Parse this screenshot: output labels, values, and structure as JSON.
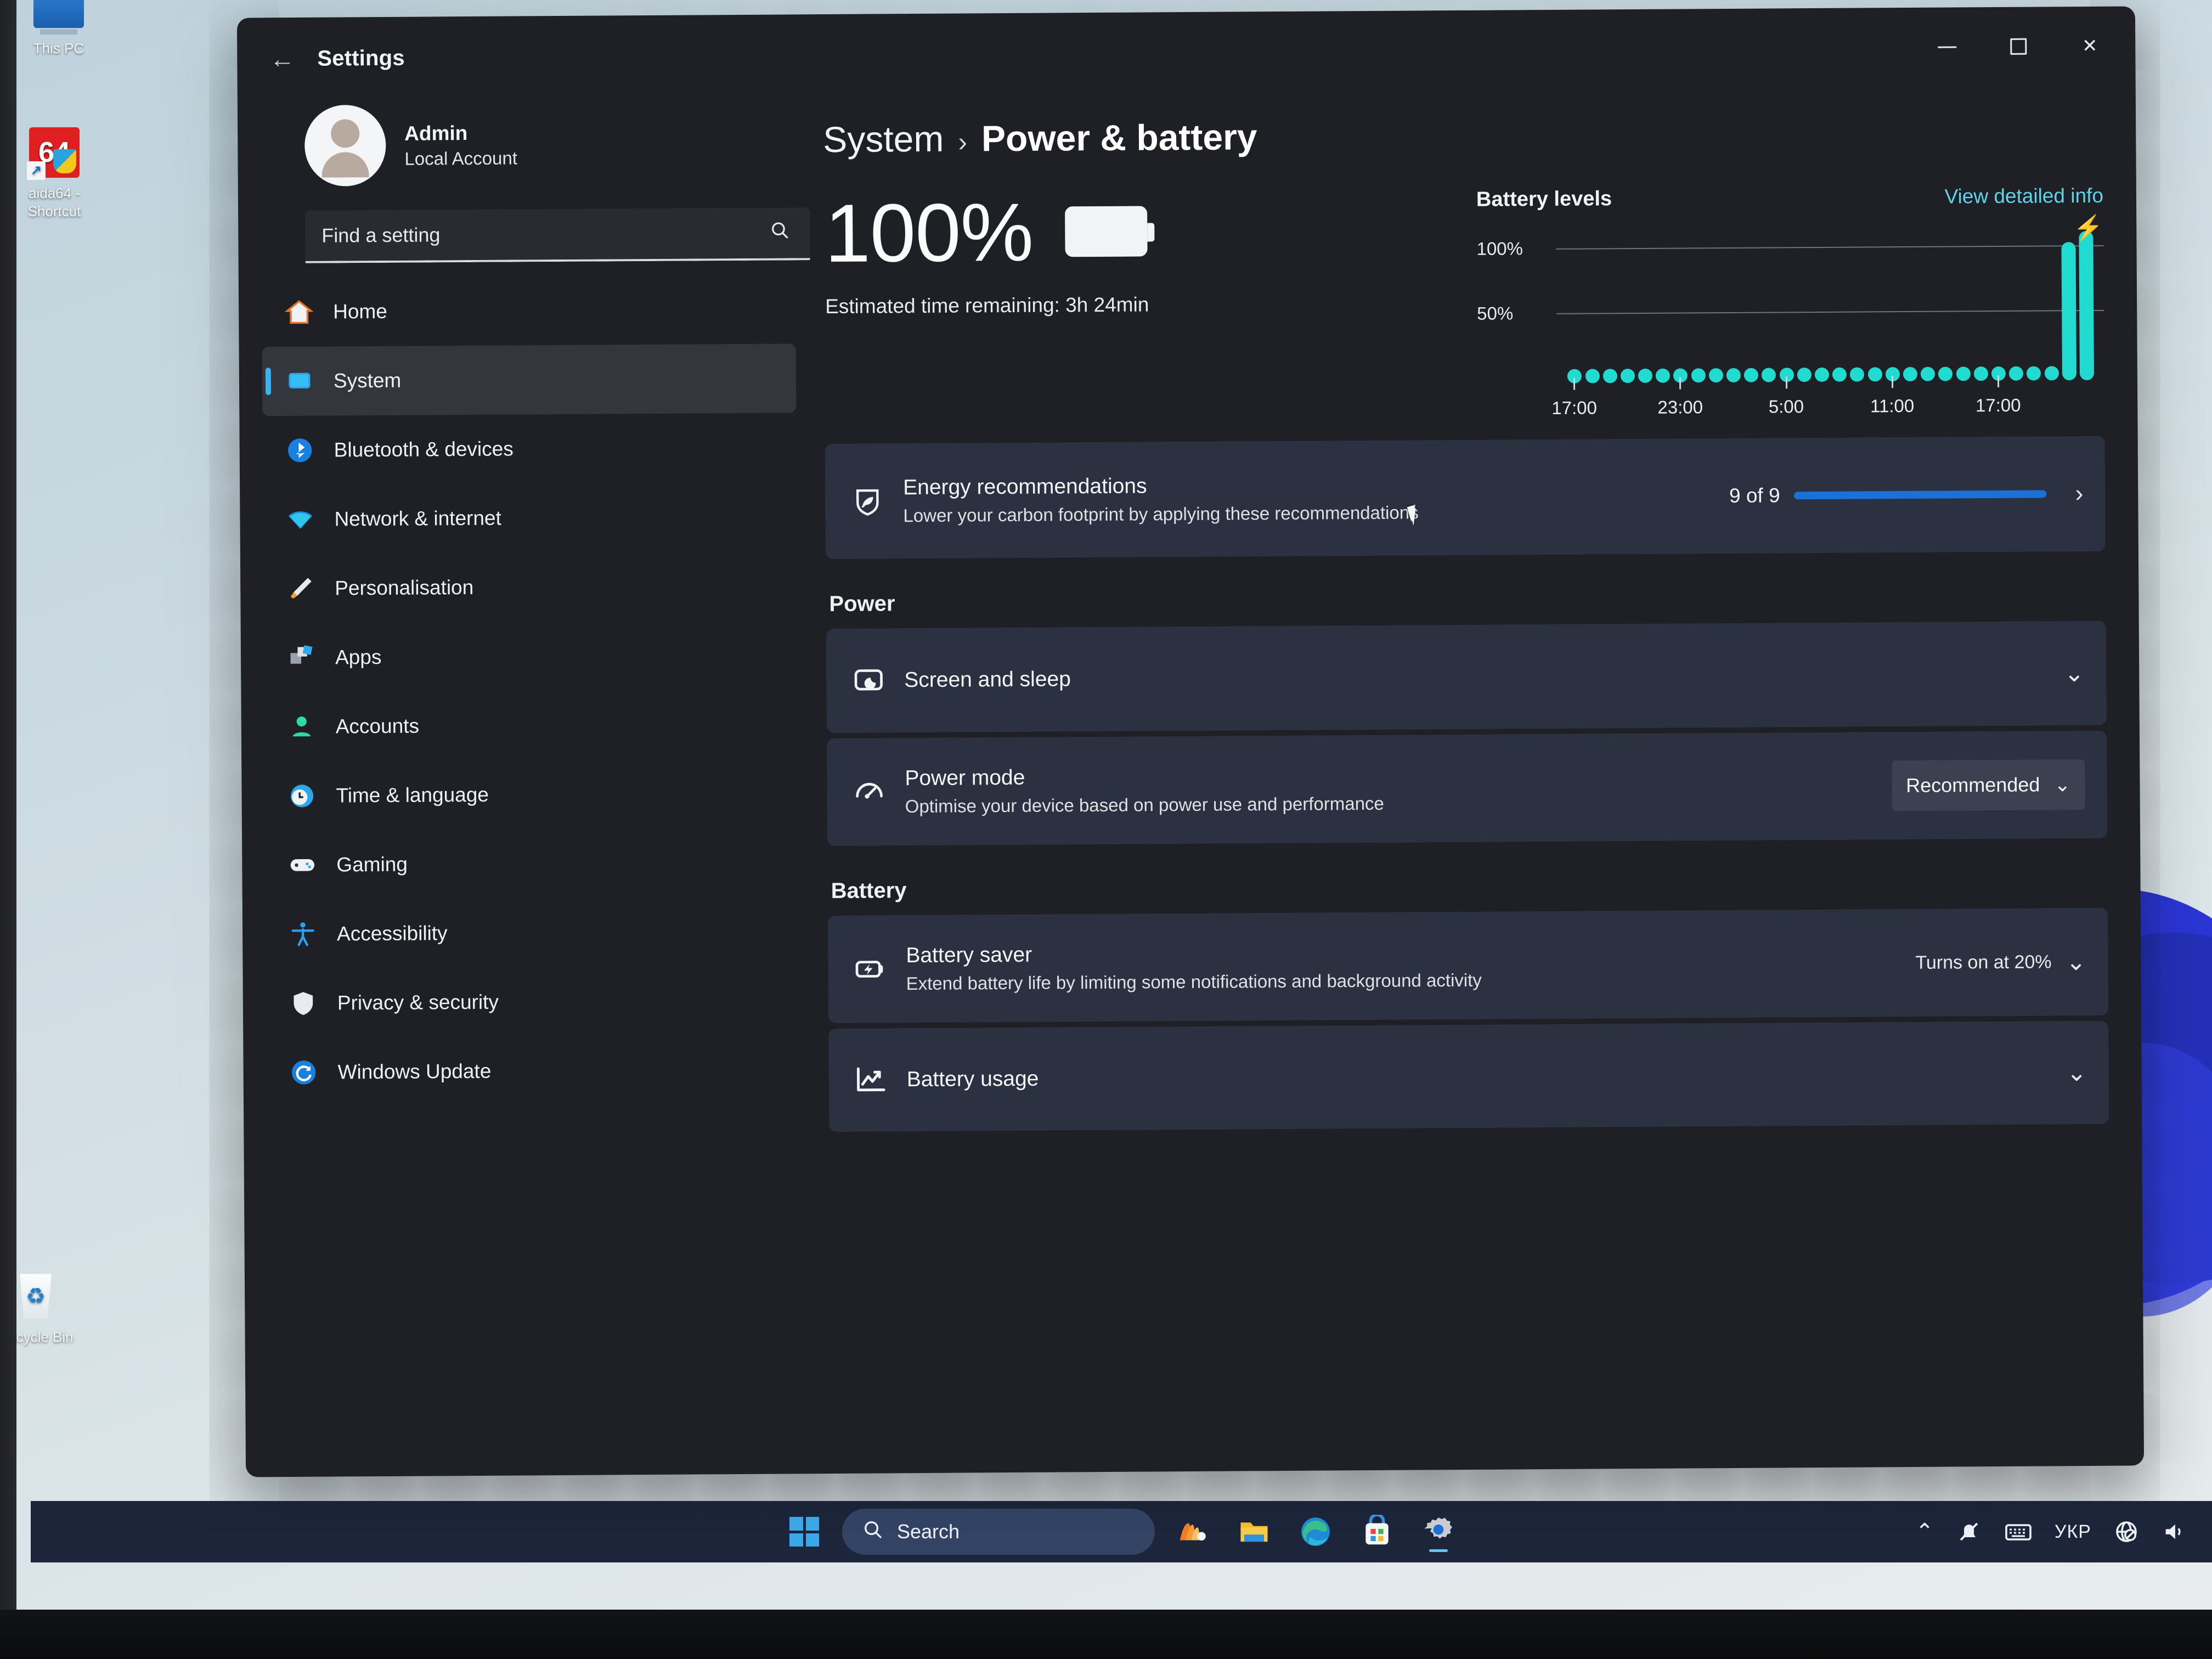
{
  "desktop": {
    "icons": [
      {
        "label": "This PC",
        "icon": "this-pc-icon"
      },
      {
        "label": "aida64 - Shortcut",
        "icon": "aida64-icon",
        "badge": "64"
      },
      {
        "label": "Recycle Bin",
        "icon": "recycle-bin-icon"
      }
    ]
  },
  "window": {
    "title": "Settings",
    "back_glyph": "←",
    "controls": {
      "minimize": "−",
      "maximize": "□",
      "close": "✕"
    }
  },
  "sidebar": {
    "account": {
      "name": "Admin",
      "subtitle": "Local Account"
    },
    "search": {
      "placeholder": "Find a setting",
      "icon": "search-icon"
    },
    "items": [
      {
        "label": "Home",
        "icon": "home-icon",
        "active": false
      },
      {
        "label": "System",
        "icon": "system-icon",
        "active": true
      },
      {
        "label": "Bluetooth & devices",
        "icon": "bluetooth-icon",
        "active": false
      },
      {
        "label": "Network & internet",
        "icon": "wifi-icon",
        "active": false
      },
      {
        "label": "Personalisation",
        "icon": "brush-icon",
        "active": false
      },
      {
        "label": "Apps",
        "icon": "apps-icon",
        "active": false
      },
      {
        "label": "Accounts",
        "icon": "account-icon",
        "active": false
      },
      {
        "label": "Time & language",
        "icon": "clock-icon",
        "active": false
      },
      {
        "label": "Gaming",
        "icon": "gamepad-icon",
        "active": false
      },
      {
        "label": "Accessibility",
        "icon": "accessibility-icon",
        "active": false
      },
      {
        "label": "Privacy & security",
        "icon": "shield-icon",
        "active": false
      },
      {
        "label": "Windows Update",
        "icon": "update-icon",
        "active": false
      }
    ]
  },
  "breadcrumb": {
    "parent": "System",
    "separator": "›",
    "current": "Power & battery"
  },
  "hero": {
    "percent": "100%",
    "battery_icon": "battery-full-icon",
    "estimated_time": "Estimated time remaining: 3h 24min"
  },
  "chart_data": {
    "type": "bar",
    "title": "Battery levels",
    "link_label": "View detailed info",
    "xlabel": "",
    "ylabel": "",
    "ylim": [
      0,
      100
    ],
    "ytick_labels": [
      "100%",
      "50%"
    ],
    "ytick_values": [
      100,
      50
    ],
    "xtick_labels": [
      "17:00",
      "23:00",
      "5:00",
      "11:00",
      "17:00"
    ],
    "xtick_positions": [
      0,
      6,
      12,
      18,
      24
    ],
    "grid": true,
    "legend": null,
    "bar_color": "#22dbd0",
    "annotation": {
      "symbol": "⚡",
      "meaning": "charging",
      "at_index": 29
    },
    "x": [
      "17:00",
      "18:00",
      "19:00",
      "20:00",
      "21:00",
      "22:00",
      "23:00",
      "00:00",
      "01:00",
      "02:00",
      "03:00",
      "04:00",
      "05:00",
      "06:00",
      "07:00",
      "08:00",
      "09:00",
      "10:00",
      "11:00",
      "12:00",
      "13:00",
      "14:00",
      "15:00",
      "16:00",
      "16:30",
      "17:00",
      "17:10",
      "17:20",
      "17:30",
      "17:40"
    ],
    "values": [
      0,
      0,
      0,
      0,
      0,
      0,
      0,
      0,
      0,
      0,
      0,
      0,
      0,
      0,
      0,
      0,
      0,
      0,
      0,
      0,
      0,
      0,
      0,
      0,
      0,
      0,
      0,
      0,
      92,
      100
    ]
  },
  "energy": {
    "icon": "leaf-shield-icon",
    "title": "Energy recommendations",
    "subtitle": "Lower your carbon footprint by applying these recommendations",
    "count": "9 of 9",
    "progress_percent": 100,
    "progress_color": "#1a72d8",
    "chevron": "›"
  },
  "power": {
    "section_title": "Power",
    "items": [
      {
        "icon": "screen-sleep-icon",
        "title": "Screen and sleep",
        "subtitle": "",
        "control": "chevron",
        "chevron": "⌄"
      },
      {
        "icon": "power-mode-icon",
        "title": "Power mode",
        "subtitle": "Optimise your device based on power use and performance",
        "control": "select",
        "selected": "Recommended",
        "chevron": "⌄"
      }
    ]
  },
  "battery": {
    "section_title": "Battery",
    "items": [
      {
        "icon": "battery-saver-icon",
        "title": "Battery saver",
        "subtitle": "Extend battery life by limiting some notifications and background activity",
        "control": "value",
        "value": "Turns on at 20%",
        "chevron": "⌄"
      },
      {
        "icon": "battery-usage-icon",
        "title": "Battery usage",
        "subtitle": "",
        "control": "chevron",
        "chevron": "⌄"
      }
    ]
  },
  "taskbar": {
    "start": {
      "icon": "windows-start-icon"
    },
    "search": {
      "placeholder": "Search",
      "icon": "search-icon"
    },
    "pinned": [
      {
        "name": "widgets-icon"
      },
      {
        "name": "file-explorer-icon"
      },
      {
        "name": "edge-browser-icon"
      },
      {
        "name": "microsoft-store-icon"
      },
      {
        "name": "settings-icon",
        "active": true
      }
    ],
    "tray": [
      {
        "name": "show-hidden-icons-chevron",
        "glyph": "⌃"
      },
      {
        "name": "notifications-muted-icon"
      },
      {
        "name": "keyboard-icon"
      },
      {
        "name": "language-indicator",
        "label": "УКР"
      },
      {
        "name": "network-blocked-icon"
      },
      {
        "name": "volume-icon"
      }
    ]
  }
}
